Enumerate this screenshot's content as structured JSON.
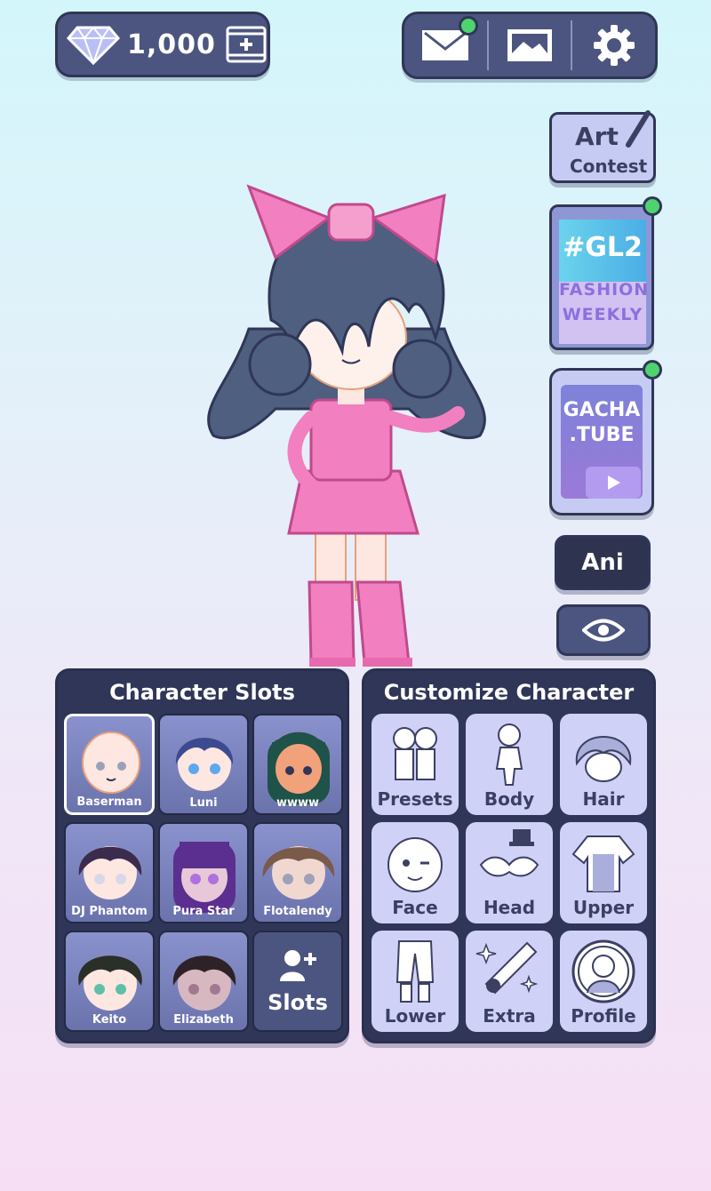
{
  "currency": {
    "amount": "1,000",
    "gem_icon": "diamond-icon",
    "add_icon": "video-plus-icon"
  },
  "top_buttons": {
    "mail_icon": "mail-icon",
    "gallery_icon": "image-icon",
    "settings_icon": "gear-icon"
  },
  "side": {
    "art_contest": {
      "line1": "Art",
      "line2": "Contest"
    },
    "gl2": {
      "tag": "#GL2",
      "line1": "FASHION",
      "line2": "WEEKLY"
    },
    "gachatube": {
      "line1": "GACHA",
      "line2": ".TUBE"
    },
    "ani_label": "Ani"
  },
  "slots_panel": {
    "title": "Character Slots",
    "slots": [
      {
        "name": "Baserman",
        "hair": "none",
        "selected": true
      },
      {
        "name": "Luni",
        "hair": "#3c4b8f"
      },
      {
        "name": "wwww",
        "hair": "#1f5249"
      },
      {
        "name": "DJ Phantom",
        "hair": "#3b2b4d"
      },
      {
        "name": "Pura Star",
        "hair": "#5a2f8f"
      },
      {
        "name": "Flotalendy",
        "hair": "#7a5a48"
      },
      {
        "name": "Keito",
        "hair": "#2a2f28"
      },
      {
        "name": "Elizabeth",
        "hair": "#2e2228"
      }
    ],
    "add_label": "Slots"
  },
  "customize_panel": {
    "title": "Customize Character",
    "buttons": [
      {
        "label": "Presets",
        "icon": "presets-icon"
      },
      {
        "label": "Body",
        "icon": "body-icon"
      },
      {
        "label": "Hair",
        "icon": "hair-icon"
      },
      {
        "label": "Face",
        "icon": "face-icon"
      },
      {
        "label": "Head",
        "icon": "head-icon"
      },
      {
        "label": "Upper",
        "icon": "upper-icon"
      },
      {
        "label": "Lower",
        "icon": "lower-icon"
      },
      {
        "label": "Extra",
        "icon": "extra-icon"
      },
      {
        "label": "Profile",
        "icon": "profile-icon"
      }
    ]
  },
  "colors": {
    "panel": "#2f3657",
    "pill": "#4b5580",
    "notify": "#4ed36f",
    "outfit_pink": "#f27fbf",
    "hair_main": "#4e5f80"
  }
}
